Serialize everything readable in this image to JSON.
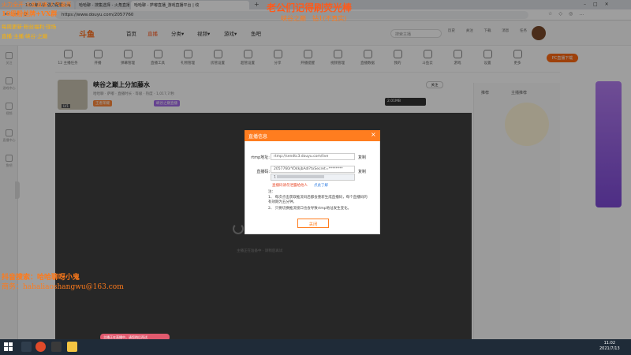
{
  "browser": {
    "tabs": [
      "1:00鬼头聊·强力配置火哥",
      "哈哈聊 - 搜集选择 - 火角直播平台",
      "哈哈聊 - 萨嘟直播_游戏直播平台 | 纹"
    ],
    "url": "https://www.douyu.com/2057760",
    "new_tab": "+"
  },
  "site": {
    "logo": "斗鱼",
    "nav": [
      "首页",
      "直播",
      "分类▾",
      "视频▾",
      "游戏▾",
      "鱼吧"
    ],
    "active_nav": "直播",
    "search_placeholder": "搜索主播",
    "header_icons": [
      "历史",
      "关注",
      "下载",
      "消息",
      "任务"
    ],
    "tools": [
      {
        "label": "12 主播任务",
        "icon": "calendar-icon"
      },
      {
        "label": "开播",
        "icon": "live-icon"
      },
      {
        "label": "弹幕管理",
        "icon": "wave-icon"
      },
      {
        "label": "直播工具",
        "icon": "controller-icon"
      },
      {
        "label": "礼物管理",
        "icon": "gift-icon"
      },
      {
        "label": "房管设置",
        "icon": "user-icon"
      },
      {
        "label": "超管设置",
        "icon": "admin-icon"
      },
      {
        "label": "分享",
        "icon": "share-icon"
      },
      {
        "label": "开播提醒",
        "icon": "bell-icon"
      },
      {
        "label": "视频管理",
        "icon": "video-icon"
      },
      {
        "label": "直播数据",
        "icon": "chart-icon"
      },
      {
        "label": "我的",
        "icon": "star-icon"
      },
      {
        "label": "斗鱼云",
        "icon": "cloud-icon"
      },
      {
        "label": "游戏",
        "icon": "gamepad-icon"
      },
      {
        "label": "设置",
        "icon": "settings-icon"
      },
      {
        "label": "更多",
        "icon": "more-icon"
      }
    ],
    "pc_button": "PC直播下载"
  },
  "sidebar": {
    "items": [
      "关注",
      "游戏中心",
      "视频",
      "直播中心",
      "鱼吧"
    ]
  },
  "room": {
    "title": "峡谷之巅上分加藤水",
    "badge_level": "LV1",
    "meta": "哈哈聊 · 萨嘟 · 直播时长 · 等级 · 热度 · 1,017,7/秒",
    "tags": [
      "王者荣耀",
      "峡谷之巅直播"
    ],
    "follow_label": "关注",
    "right_tabs": [
      "推荐",
      "主播推荐"
    ]
  },
  "player": {
    "loading_hint": "主播正在准备中 · 请稍后再试",
    "progress_text": "2.01MB"
  },
  "dialog": {
    "title": "直播信息",
    "close": "×",
    "rtmp_label": "rtmp地址:",
    "rtmp_value": "rtmp://sendtc3.douyu.com/live",
    "copy1": "复制",
    "code_label": "直播码:",
    "code_value": "2057760rYO4kjbAdl?txSecret=********",
    "copy2": "复制",
    "select_value": "1",
    "warning": "直播码请勿泄露给他人",
    "learn_more": "点此了解",
    "notes": [
      "注：",
      "1、 每次点击获取推流码后都会重新生成直播码，每个直播码的有效期为五分钟。",
      "2、 只要切换推流接口也会导致rtmp地址发生变化。"
    ],
    "ok_button": "关闭"
  },
  "watermarks": {
    "top_left_1": "火力全开·斗鱼直播·人气最高",
    "top_left_2": "10级粉丝牌+VX群",
    "top_left_3": "每周更新·粉丝福利·现场",
    "top_left_4": "直播·主播·峡谷·之巅",
    "top_center_1": "老公们记得刷荧光棒",
    "top_center_2": "峡谷之巅　钻1(不真实)",
    "bottom_left_1": "抖音搜索：哈哈聊呀小鬼",
    "bottom_left_2": "商务：hahaliaoshangwu@163.com"
  },
  "toast": "主播正在直播中，请您稍后再试",
  "taskbar": {
    "time": "11:02",
    "date": "2021/7/13"
  }
}
